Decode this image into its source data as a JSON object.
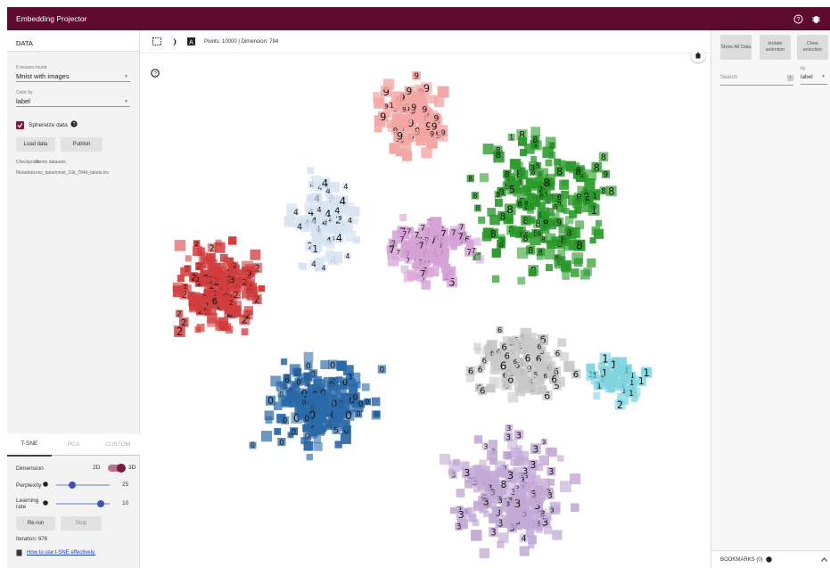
{
  "app": {
    "title": "Embedding Projector"
  },
  "left": {
    "header": "DATA",
    "tensors_label": "5 tensors found",
    "tensors_value": "Mnist with images",
    "color_label": "Color by",
    "color_value": "label",
    "sphereize_label": "Sphereize data",
    "load_label": "Load data",
    "publish_label": "Publish",
    "checkpoint_key": "Checkpoint:",
    "checkpoint_val": "Demo datasets",
    "metadata_key": "Metadata:",
    "metadata_val": "oss_data/mnist_10k_784d_labels.tsv",
    "tabs": [
      "T-SNE",
      "PCA",
      "CUSTOM"
    ],
    "dimension_label": "Dimension",
    "dim_2d": "2D",
    "dim_3d": "3D",
    "perplexity_label": "Perplexity",
    "perplexity_value": "25",
    "perplexity_level": 0.3,
    "lr_label": "Learning rate",
    "lr_value": "10",
    "lr_level": 0.83,
    "rerun_label": "Re-run",
    "stop_label": "Stop",
    "iteration": "Iteration: 676",
    "tsne_link": "How to use t-SNE effectively."
  },
  "toolbar": {
    "points_text": "Points: 10000 | Dimension: 784"
  },
  "right": {
    "show_all": "Show All Data",
    "isolate": "Isolate selection",
    "clear": "Clear selection",
    "search_placeholder": "Search",
    "by_label": "by",
    "by_value": "label",
    "bookmarks": "BOOKMARKS (0)"
  },
  "colors": {
    "brand": "#5d0a2f",
    "cluster_green": "#2a9a2a",
    "cluster_red": "#d13d3d",
    "cluster_blue": "#2b6aa8",
    "cluster_purple": "#c3aad6",
    "cluster_pink": "#f3a6a4",
    "cluster_violet": "#d6a2d6",
    "cluster_lightblue": "#d7e3f2",
    "cluster_grey": "#c8c8c8",
    "cluster_cyan": "#7fd4e0"
  },
  "visible_labels": {
    "sample_digits": [
      "3",
      "5",
      "8",
      "0",
      "2",
      "9",
      "6",
      "7",
      "4",
      "1"
    ]
  }
}
